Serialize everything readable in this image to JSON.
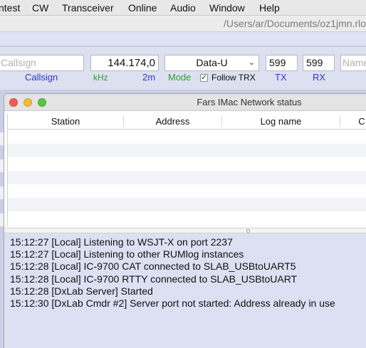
{
  "menubar": {
    "items": [
      "ntest",
      "CW",
      "Transceiver",
      "Online",
      "Audio",
      "Window",
      "Help"
    ]
  },
  "pathbar": {
    "path": "/Users/ar/Documents/oz1jmn.rlo"
  },
  "entry": {
    "callsign_placeholder": "Callsign",
    "callsign_label": "Callsign",
    "frequency_value": "144.174,0",
    "khz_label": "kHz",
    "band_label": "2m",
    "mode_value": "Data-U",
    "mode_label": "Mode",
    "follow_trx_label": "Follow TRX",
    "follow_trx_checked": true,
    "tx_value": "599",
    "tx_label": "TX",
    "rx_value": "599",
    "rx_label": "RX",
    "name_placeholder": "Name"
  },
  "window": {
    "title": "Fars IMac Network status",
    "columns": [
      "Station",
      "Address",
      "Log name",
      "C"
    ],
    "log_lines": [
      "15:12:27 [Local] Listening to WSJT-X on port 2237",
      "15:12:27 [Local] Listening to other RUMlog instances",
      "15:12:28 [Local] IC-9700 CAT connected to SLAB_USBtoUART5",
      "15:12:28 [Local] IC-9700 RTTY connected to SLAB_USBtoUART",
      "15:12:28 [DxLab Server] Started",
      "15:12:30 [DxLab Cmdr #2] Server port not started: Address already in use"
    ]
  },
  "colors": {
    "label_blue": "#2a39c9",
    "label_green": "#2f9d2f",
    "log_background": "#dde0f2",
    "close_button": "#ec5f57",
    "minimize_button": "#f2bb3b",
    "zoom_button": "#5bc445"
  },
  "icons": [
    "chevron-down-icon",
    "checkbox-checked-icon",
    "close-window-icon",
    "minimize-window-icon",
    "zoom-window-icon"
  ]
}
